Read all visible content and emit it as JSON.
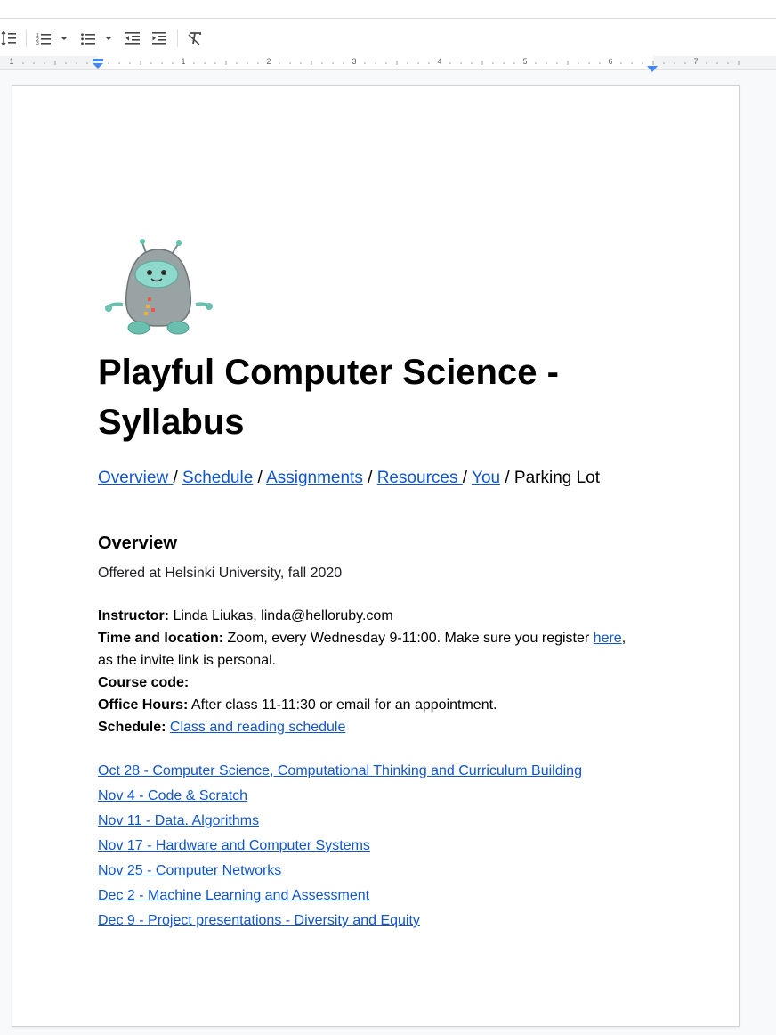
{
  "toolbar": {
    "icons": [
      "line-spacing-icon",
      "numbered-list-icon",
      "bulleted-list-icon",
      "decrease-indent-icon",
      "increase-indent-icon",
      "clear-formatting-icon"
    ]
  },
  "ruler": {
    "numbers": [
      "1",
      "1",
      "2",
      "3",
      "4",
      "5",
      "6",
      "7"
    ]
  },
  "doc": {
    "title": "Playful Computer Science - Syllabus",
    "nav": {
      "overview": "Overview ",
      "sep1": " / ",
      "schedule": "Schedule",
      "sep2": " / ",
      "assignments": "Assignments",
      "sep3": " / ",
      "resources": "Resources ",
      "sep4": "/ ",
      "you": "You",
      "sep5": " / Parking Lot"
    },
    "overview_heading": "Overview",
    "offered": "Offered at Helsinki University, fall 2020",
    "instructor_label": "Instructor:",
    "instructor_value": " Linda Liukas, linda@helloruby.com",
    "time_label": "Time and location:",
    "time_value": " Zoom, every Wednesday 9-11:00. Make sure you register ",
    "time_link": "here",
    "time_tail": ",",
    "time_line2": "as the invite link is personal.",
    "course_code_label": "Course code:",
    "office_label": "Office Hours:",
    "office_value": " After class 11-11:30 or email for an appointment.",
    "schedule_label": "Schedule:",
    "schedule_link": "Class and reading schedule",
    "sessions": [
      "Oct 28 - Computer Science, Computational Thinking and Curriculum Building",
      "Nov 4 - Code & Scratch",
      "Nov 11 - Data. Algorithms",
      "Nov 17 - Hardware and Computer Systems",
      "Nov 25 - Computer Networks",
      "Dec 2 - Machine Learning and Assessment",
      "Dec 9 - Project presentations - Diversity and Equity"
    ]
  },
  "colors": {
    "link": "#1155cc",
    "page_bg": "#ffffff",
    "app_bg": "#f8f9fa"
  }
}
